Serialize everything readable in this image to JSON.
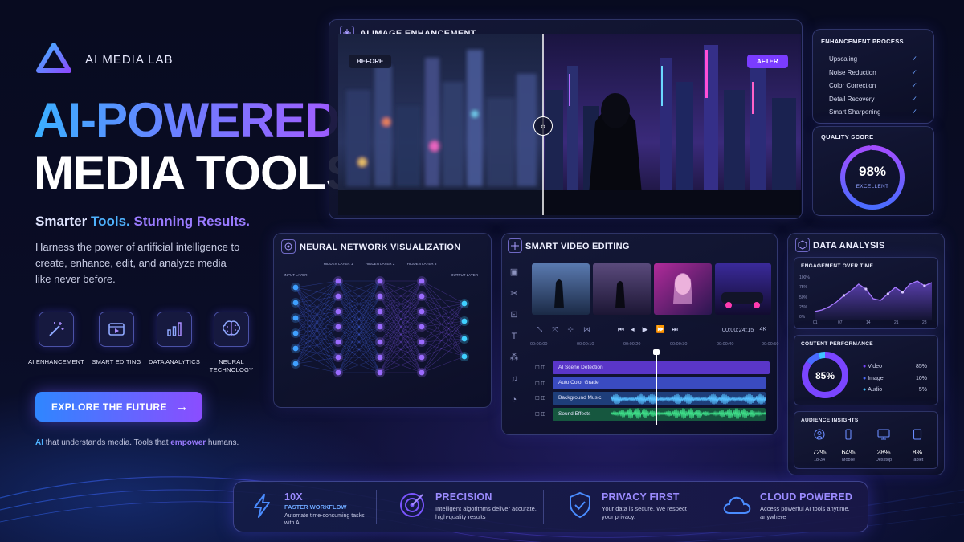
{
  "brand": {
    "name": "AI MEDIA LAB"
  },
  "hero": {
    "line1": "AI-POWERED",
    "line2": "MEDIA TOOLS",
    "tag_a": "Smarter ",
    "tag_b": "Tools. ",
    "tag_c": "Stunning Results.",
    "desc": "Harness the power of artificial intelligence to create, enhance, edit, and analyze media like never before."
  },
  "features": [
    {
      "label": "AI ENHANCEMENT",
      "icon": "magic-wand-icon"
    },
    {
      "label": "SMART EDITING",
      "icon": "video-edit-icon"
    },
    {
      "label": "DATA ANALYTICS",
      "icon": "bar-chart-icon"
    },
    {
      "label": "NEURAL TECHNOLOGY",
      "icon": "brain-icon"
    }
  ],
  "cta": {
    "label": "EXPLORE THE FUTURE"
  },
  "footer_line": {
    "a": "AI",
    "b": " that understands media. Tools that ",
    "c": "empower",
    "d": " humans."
  },
  "enhance": {
    "title": "AI IMAGE ENHANCEMENT",
    "before": "BEFORE",
    "after": "AFTER"
  },
  "process": {
    "title": "ENHANCEMENT PROCESS",
    "steps": [
      "Upscaling",
      "Noise Reduction",
      "Color Correction",
      "Detail Recovery",
      "Smart Sharpening"
    ]
  },
  "quality": {
    "title": "QUALITY SCORE",
    "value": "98%",
    "rating": "EXCELLENT",
    "percent": 98
  },
  "neural": {
    "title": "NEURAL NETWORK VISUALIZATION",
    "layers": [
      "INPUT LAYER",
      "HIDDEN LAYER 1",
      "HIDDEN LAYER 2",
      "HIDDEN LAYER 3",
      "OUTPUT LAYER"
    ]
  },
  "video": {
    "title": "SMART VIDEO EDITING",
    "time": "00:00:24:15",
    "res": "4K",
    "ticks": [
      "00:00:00",
      "00:00:10",
      "00:00:20",
      "00:00:30",
      "00:00:40",
      "00:00:50"
    ],
    "tracks": [
      "AI Scene Detection",
      "Auto Color Grade",
      "Background Music",
      "Sound Effects"
    ]
  },
  "analysis": {
    "title": "DATA ANALYSIS",
    "engagement": {
      "title": "ENGAGEMENT OVER TIME",
      "yticks": [
        "100%",
        "75%",
        "50%",
        "25%",
        "0%"
      ],
      "xticks": [
        "01",
        "07",
        "14",
        "21",
        "28"
      ]
    },
    "content": {
      "title": "CONTENT PERFORMANCE",
      "center": "85%",
      "items": [
        {
          "name": "Video",
          "value": "85%"
        },
        {
          "name": "Image",
          "value": "10%"
        },
        {
          "name": "Audio",
          "value": "5%"
        }
      ]
    },
    "audience": {
      "title": "AUDIENCE INSIGHTS",
      "items": [
        {
          "value": "72%",
          "label": "18-34",
          "icon": "user-icon"
        },
        {
          "value": "64%",
          "label": "Mobile",
          "icon": "phone-icon"
        },
        {
          "value": "28%",
          "label": "Desktop",
          "icon": "desktop-icon"
        },
        {
          "value": "8%",
          "label": "Tablet",
          "icon": "tablet-icon"
        }
      ]
    }
  },
  "bottom": [
    {
      "head": "10X",
      "sub": "FASTER WORKFLOW",
      "text": "Automate time-consuming tasks with AI",
      "icon": "lightning-icon"
    },
    {
      "head": "PRECISION",
      "text": "Intelligent algorithms deliver accurate, high-quality results",
      "icon": "target-icon"
    },
    {
      "head": "PRIVACY FIRST",
      "text": "Your data is secure. We respect your privacy.",
      "icon": "shield-icon"
    },
    {
      "head": "CLOUD POWERED",
      "text": "Access powerful AI tools anytime, anywhere",
      "icon": "cloud-icon"
    }
  ],
  "colors": {
    "accent_blue": "#3aa8ff",
    "accent_purple": "#8a5cff",
    "check": "#6aa0ff"
  }
}
